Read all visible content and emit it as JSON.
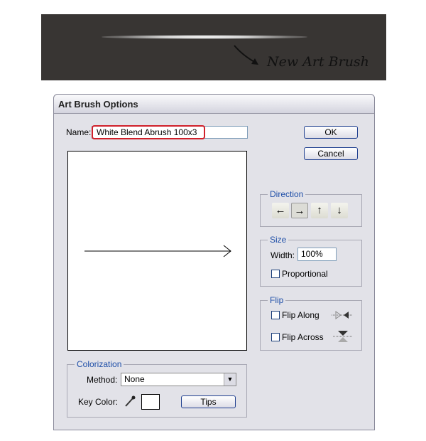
{
  "banner": {
    "label": "New Art Brush",
    "background": "#383533"
  },
  "dialog": {
    "title": "Art Brush Options",
    "name_label": "Name:",
    "name_value": "White Blend Abrush 100x3",
    "highlight_color": "#d0202a",
    "ok_label": "OK",
    "cancel_label": "Cancel",
    "direction": {
      "legend": "Direction",
      "buttons": [
        "←",
        "→",
        "↑",
        "↓"
      ],
      "selected": "→"
    },
    "size": {
      "legend": "Size",
      "width_label": "Width:",
      "width_value": "100%",
      "proportional_label": "Proportional",
      "proportional_checked": false
    },
    "flip": {
      "legend": "Flip",
      "along_label": "Flip Along",
      "along_checked": false,
      "across_label": "Flip Across",
      "across_checked": false
    },
    "colorization": {
      "legend": "Colorization",
      "method_label": "Method:",
      "method_value": "None",
      "key_color_label": "Key Color:",
      "key_color": "#ffffff",
      "tips_label": "Tips"
    }
  }
}
